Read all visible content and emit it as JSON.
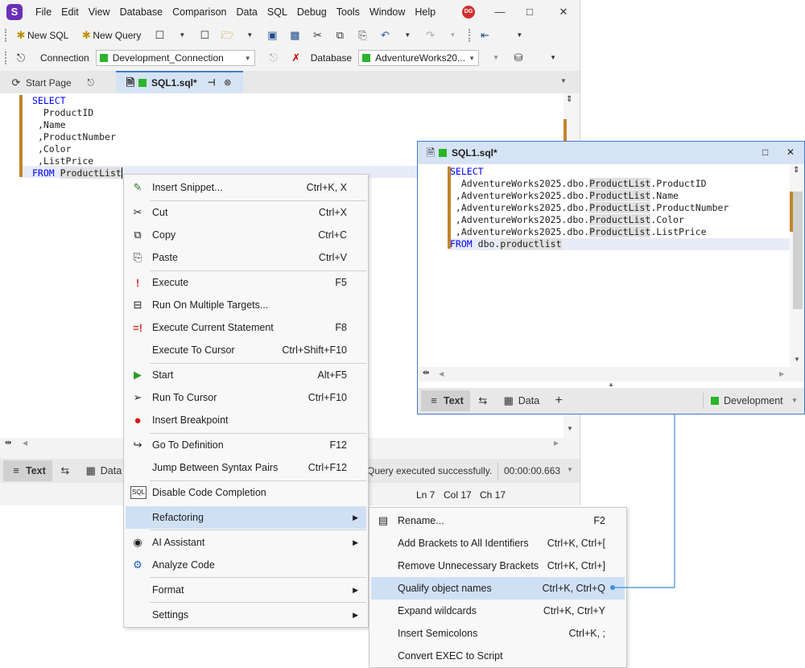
{
  "menubar": {
    "items": [
      "File",
      "Edit",
      "View",
      "Database",
      "Comparison",
      "Data",
      "SQL",
      "Debug",
      "Tools",
      "Window",
      "Help"
    ],
    "avatar": "DG"
  },
  "toolbar": {
    "new_sql": "New SQL",
    "new_query": "New Query",
    "connection_label": "Connection",
    "connection_value": "Development_Connection",
    "database_label": "Database",
    "database_value": "AdventureWorks20..."
  },
  "tabs": {
    "start_page": "Start Page",
    "sql1": "SQL1.sql*"
  },
  "editor": {
    "line1": "SELECT",
    "line2": "ProductID",
    "line3": ",Name",
    "line4": ",ProductNumber",
    "line5": ",Color",
    "line6": ",ListPrice",
    "line7_kw": "FROM",
    "line7_obj": "ProductList"
  },
  "bottom": {
    "text_tab": "Text",
    "data_tab": "Data",
    "status_message": "Query executed successfully.",
    "elapsed": "00:00:00.663",
    "ln": "Ln 7",
    "col": "Col 17",
    "ch": "Ch 17"
  },
  "context_menu": [
    {
      "label": "Insert Snippet...",
      "shortcut": "Ctrl+K, X"
    },
    {
      "label": "Cut",
      "shortcut": "Ctrl+X"
    },
    {
      "label": "Copy",
      "shortcut": "Ctrl+C"
    },
    {
      "label": "Paste",
      "shortcut": "Ctrl+V"
    },
    {
      "label": "Execute",
      "shortcut": "F5"
    },
    {
      "label": "Run On Multiple Targets...",
      "shortcut": ""
    },
    {
      "label": "Execute Current Statement",
      "shortcut": "F8"
    },
    {
      "label": "Execute To Cursor",
      "shortcut": "Ctrl+Shift+F10"
    },
    {
      "label": "Start",
      "shortcut": "Alt+F5"
    },
    {
      "label": "Run To Cursor",
      "shortcut": "Ctrl+F10"
    },
    {
      "label": "Insert Breakpoint",
      "shortcut": ""
    },
    {
      "label": "Go To Definition",
      "shortcut": "F12"
    },
    {
      "label": "Jump Between Syntax Pairs",
      "shortcut": "Ctrl+F12"
    },
    {
      "label": "Disable Code Completion",
      "shortcut": ""
    },
    {
      "label": "Refactoring",
      "shortcut": ""
    },
    {
      "label": "AI Assistant",
      "shortcut": ""
    },
    {
      "label": "Analyze Code",
      "shortcut": ""
    },
    {
      "label": "Format",
      "shortcut": ""
    },
    {
      "label": "Settings",
      "shortcut": ""
    }
  ],
  "submenu": [
    {
      "label": "Rename...",
      "shortcut": "F2"
    },
    {
      "label": "Add Brackets to All Identifiers",
      "shortcut": "Ctrl+K, Ctrl+["
    },
    {
      "label": "Remove Unnecessary Brackets",
      "shortcut": "Ctrl+K, Ctrl+]"
    },
    {
      "label": "Qualify object names",
      "shortcut": "Ctrl+K, Ctrl+Q"
    },
    {
      "label": "Expand wildcards",
      "shortcut": "Ctrl+K, Ctrl+Y"
    },
    {
      "label": "Insert Semicolons",
      "shortcut": "Ctrl+K, ;"
    },
    {
      "label": "Convert EXEC to Script",
      "shortcut": ""
    }
  ],
  "preview": {
    "title": "SQL1.sql*",
    "select": "SELECT",
    "db": "AdventureWorks2025",
    "schema": "dbo",
    "table": "ProductList",
    "columns": [
      "ProductID",
      "Name",
      "ProductNumber",
      "Color",
      "ListPrice"
    ],
    "from_kw": "FROM",
    "from_obj_schema": "dbo.",
    "from_obj_table": "productlist",
    "text_tab": "Text",
    "data_tab": "Data",
    "connection": "Development"
  },
  "colors": {
    "accent": "#3f7cc7",
    "highlight": "#cfe0f5",
    "connection_green": "#2ab52a",
    "gutter_mark": "#c1852a"
  }
}
